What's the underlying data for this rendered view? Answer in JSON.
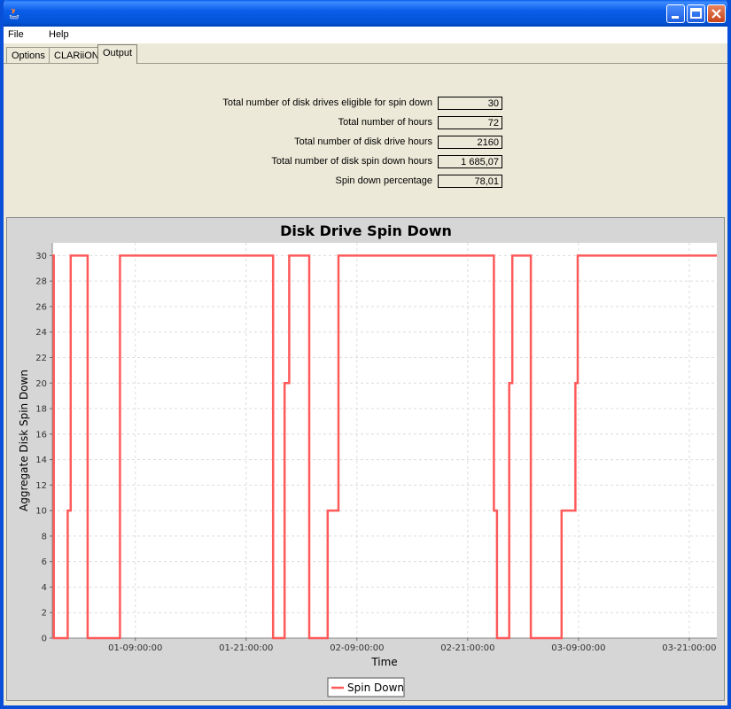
{
  "menu": {
    "file": "File",
    "help": "Help"
  },
  "tabs": [
    {
      "label": "Options"
    },
    {
      "label": "CLARiiON"
    },
    {
      "label": "Output"
    }
  ],
  "stats": [
    {
      "label": "Total number of disk drives eligible for spin down",
      "value": "30"
    },
    {
      "label": "Total number of hours",
      "value": "72"
    },
    {
      "label": "Total number of disk drive hours",
      "value": "2160"
    },
    {
      "label": "Total number of disk spin down hours",
      "value": "1 685,07"
    },
    {
      "label": "Spin down percentage",
      "value": "78,01"
    }
  ],
  "chart_data": {
    "type": "line",
    "title": "Disk Drive Spin Down",
    "xlabel": "Time",
    "ylabel": "Aggregate Disk Spin Down",
    "ylim": [
      0,
      31
    ],
    "xlim": [
      "01-00:00:00",
      "03-23:59:00"
    ],
    "yticks": [
      0,
      2,
      4,
      6,
      8,
      10,
      12,
      14,
      16,
      18,
      20,
      22,
      24,
      26,
      28,
      30
    ],
    "xticks": [
      "01-09:00:00",
      "01-21:00:00",
      "02-09:00:00",
      "02-21:00:00",
      "03-09:00:00",
      "03-21:00:00"
    ],
    "grid": true,
    "legend_position": "bottom",
    "series": [
      {
        "name": "Spin Down",
        "color": "#ff5a5a",
        "step": true,
        "points": [
          [
            "01-00:00:00",
            30
          ],
          [
            "01-00:10:00",
            0
          ],
          [
            "01-01:40:00",
            10
          ],
          [
            "01-02:00:00",
            30
          ],
          [
            "01-03:50:00",
            0
          ],
          [
            "01-07:30:00",
            30
          ],
          [
            "01-23:55:00",
            0
          ],
          [
            "01-01:00:00+23:30",
            0
          ]
        ]
      }
    ],
    "series_steps": [
      {
        "t": "01-00:00:00",
        "v": 30
      },
      {
        "t": "01-00:10:00",
        "v": 0
      },
      {
        "t": "01-01:40:00",
        "v": 10
      },
      {
        "t": "01-02:00:00",
        "v": 30
      },
      {
        "t": "01-03:50:00",
        "v": 0
      },
      {
        "t": "01-07:20:00",
        "v": 30
      },
      {
        "t": "01-23:55:00",
        "v": 0
      },
      {
        "t": "02-01:10:00",
        "v": 20
      },
      {
        "t": "02-01:40:00",
        "v": 30
      },
      {
        "t": "02-03:50:00",
        "v": 0
      },
      {
        "t": "02-05:50:00",
        "v": 10
      },
      {
        "t": "02-07:00:00",
        "v": 30
      },
      {
        "t": "02-23:50:00",
        "v": 10
      },
      {
        "t": "03-00:10:00",
        "v": 0
      },
      {
        "t": "03-01:30:00",
        "v": 20
      },
      {
        "t": "03-01:50:00",
        "v": 30
      },
      {
        "t": "03-03:50:00",
        "v": 0
      },
      {
        "t": "03-07:10:00",
        "v": 10
      },
      {
        "t": "03-08:40:00",
        "v": 20
      },
      {
        "t": "03-08:55:00",
        "v": 30
      },
      {
        "t": "03-23:59:00",
        "v": 30
      }
    ]
  }
}
